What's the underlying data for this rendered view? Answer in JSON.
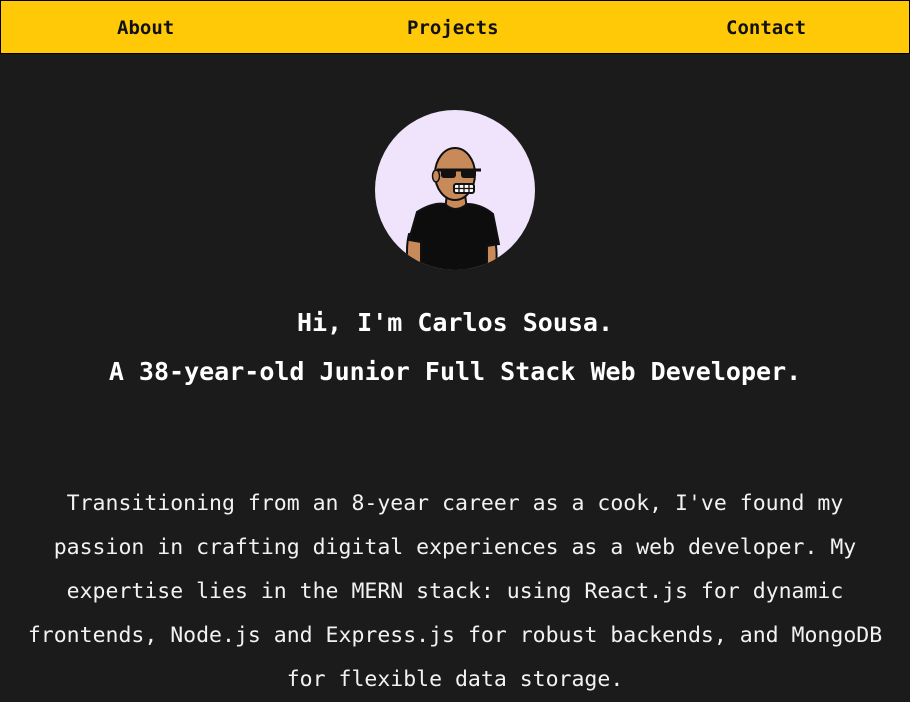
{
  "nav": {
    "items": [
      {
        "label": "About"
      },
      {
        "label": "Projects"
      },
      {
        "label": "Contact"
      }
    ]
  },
  "avatar": {
    "icon": "avatar-cartoon-man-sunglasses",
    "background_color": "#efe4fb"
  },
  "hero": {
    "greeting": "Hi, I'm Carlos Sousa.",
    "tagline": "A 38-year-old Junior Full Stack Web Developer.",
    "bio": "Transitioning from an 8-year career as a cook, I've found my passion in crafting digital experiences as a web developer. My expertise lies in the MERN stack: using React.js for dynamic frontends, Node.js and Express.js for robust backends, and MongoDB for flexible data storage."
  },
  "colors": {
    "navbar": "#ffc907",
    "background": "#1b1b1b",
    "text": "#ffffff"
  }
}
